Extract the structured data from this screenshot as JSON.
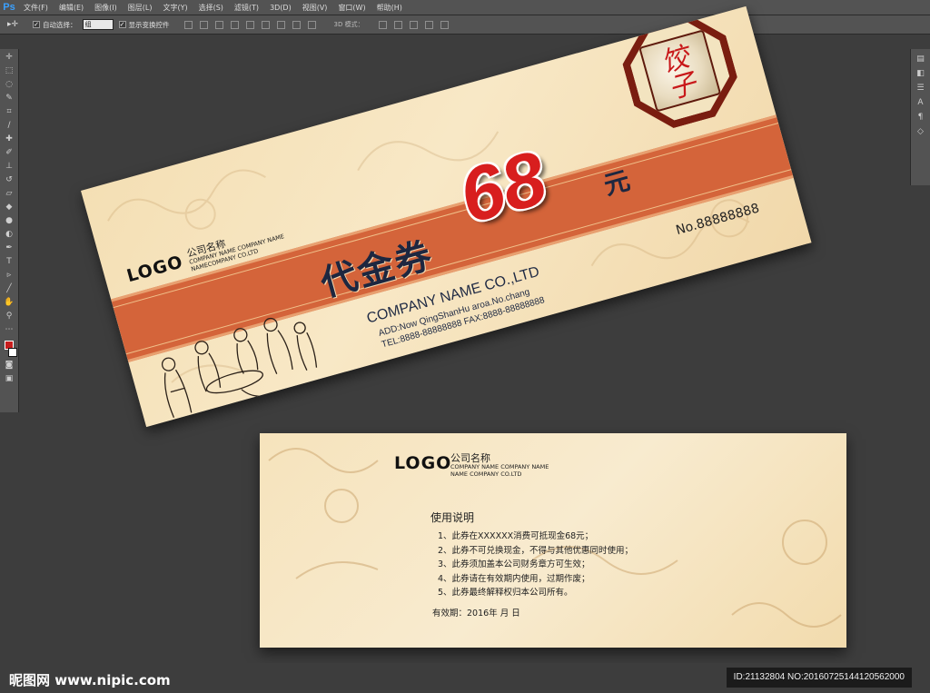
{
  "app": {
    "logo": "Ps"
  },
  "menu": [
    "文件(F)",
    "编辑(E)",
    "图像(I)",
    "图层(L)",
    "文字(Y)",
    "选择(S)",
    "滤镜(T)",
    "3D(D)",
    "视图(V)",
    "窗口(W)",
    "帮助(H)"
  ],
  "options": {
    "tool_icon": "move-icon",
    "auto_select_label": "自动选择：",
    "auto_select_value": "组",
    "show_transform_label": "显示变换控件",
    "mode_3d_label": "3D 模式："
  },
  "tools": [
    "move-icon",
    "marquee-icon",
    "lasso-icon",
    "quick-select-icon",
    "crop-icon",
    "eyedropper-icon",
    "healing-icon",
    "brush-icon",
    "stamp-icon",
    "history-brush-icon",
    "eraser-icon",
    "gradient-icon",
    "blur-icon",
    "dodge-icon",
    "pen-icon",
    "type-icon",
    "path-select-icon",
    "shape-icon",
    "hand-icon",
    "zoom-icon"
  ],
  "colors": {
    "foreground": "#c81e1e",
    "background": "#ffffff",
    "band": "#d4643a",
    "amount": "#d81e1e"
  },
  "front": {
    "logo": "LOGO",
    "company_cn": "公司名称",
    "company_en1": "COMPANY NAME COMPANY NAME",
    "company_en2": "NAMECOMPANY CO.LTD",
    "title": "代金券",
    "amount": "68",
    "unit": "元",
    "number": "No.88888888",
    "company": "COMPANY NAME CO.,LTD",
    "address": "ADD:Now QingShanHu aroa.No.chang",
    "tel": "TEL:8888-88888888   FAX:8888-88888888",
    "badge_text": "饺子"
  },
  "back": {
    "logo": "LOGO",
    "company_cn": "公司名称",
    "company_en1": "COMPANY NAME COMPANY NAME",
    "company_en2": "NAME COMPANY CO.LTD",
    "heading": "使用说明",
    "rules": [
      "1、此券在XXXXXX消费可抵现金68元；",
      "2、此券不可兑换现金，不得与其他优惠同时使用；",
      "3、此券须加盖本公司财务章方可生效；",
      "4、此券请在有效期内使用，过期作废；",
      "5、此券最终解释权归本公司所有。"
    ],
    "valid": "有效期：2016年    月    日"
  },
  "footer": {
    "watermark": "昵图网 www.nipic.com",
    "id_text": "ID:21132804 NO:20160725144120562000"
  }
}
